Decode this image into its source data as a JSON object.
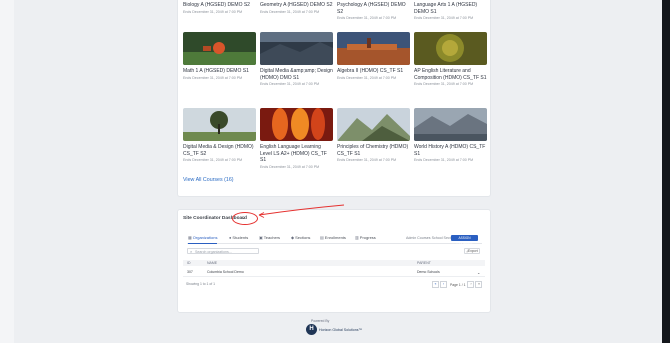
{
  "courses": {
    "top_row": [
      {
        "title": "Biology A (HGSED) DEMO S2",
        "ends": "Ends December 31, 2049 at 7:00 PM"
      },
      {
        "title": "Geometry A (HGSED) DEMO S2",
        "ends": "Ends December 31, 2049 at 7:00 PM"
      },
      {
        "title": "Psychology A (HGSED) DEMO S2",
        "ends": "Ends December 31, 2049 at 7:00 PM"
      },
      {
        "title": "Language Arts 1 A (HGSED) DEMO S1",
        "ends": "Ends December 31, 2049 at 7:00 PM"
      }
    ],
    "middle_row": [
      {
        "title": "Math 1 A (HGSED) DEMO S1",
        "ends": "Ends December 31, 2049 at 7:00 PM",
        "thumb_color": "#4e7a3a"
      },
      {
        "title": "Digital Media &amp;amp; Design (HDMO) DMO S1",
        "ends": "Ends December 31, 2049 at 7:00 PM",
        "thumb_color": "#46556a"
      },
      {
        "title": "Algebra II (HDMO) CS_TF S1",
        "ends": "Ends December 31, 2049 at 7:00 PM",
        "thumb_color": "#a5552c"
      },
      {
        "title": "AP English Literature and Composition (HDMO) CS_TF S1",
        "ends": "Ends December 31, 2049 at 7:00 PM",
        "thumb_color": "#8c8a2a"
      }
    ],
    "bottom_row": [
      {
        "title": "Digital Media & Design (HDMO) CS_TF S2",
        "ends": "Ends December 31, 2049 at 7:00 PM",
        "thumb_color": "#6f8a4f"
      },
      {
        "title": "English Language Learning Level LS A2+ (HDMO) CS_TF S1",
        "ends": "Ends December 31, 2049 at 7:00 PM",
        "thumb_color": "#d2441a"
      },
      {
        "title": "Principles of Chemistry (HDMO) CS_TF S1",
        "ends": "Ends December 31, 2049 at 7:00 PM",
        "thumb_color": "#7d8f6a"
      },
      {
        "title": "World History A (HDMO) CS_TF S1",
        "ends": "Ends December 31, 2049 at 7:00 PM",
        "thumb_color": "#8a94a0"
      }
    ],
    "view_all": "View All Courses (16)"
  },
  "coordinator": {
    "title": "Site Coordinator Dashboard",
    "chevron": "⌄",
    "tabs": [
      "Organizations",
      "Students",
      "Teachers",
      "Sections",
      "Enrollments",
      "Progress"
    ],
    "admin_label": "Admin Courses School Sections",
    "assign_button": "ASSIGN COURSES",
    "search_placeholder": "Search organizations...",
    "export_label": "Export",
    "table": {
      "headers": [
        "ID",
        "NAME",
        "PARENT"
      ],
      "rows": [
        {
          "id": "307",
          "name": "Columbia School Demo",
          "parent": "Demo Schools"
        }
      ]
    },
    "showing": "Showing 1 to 1 of 1",
    "pager_text": "Page 1 / 1"
  },
  "footer": {
    "powered_by": "Powered By",
    "logo_letter": "H",
    "brand": "Horizon Global Solutions™"
  },
  "colors": {
    "accent": "#2a5fc1",
    "link": "#2b6cc4",
    "annotation": "#e5312f"
  }
}
